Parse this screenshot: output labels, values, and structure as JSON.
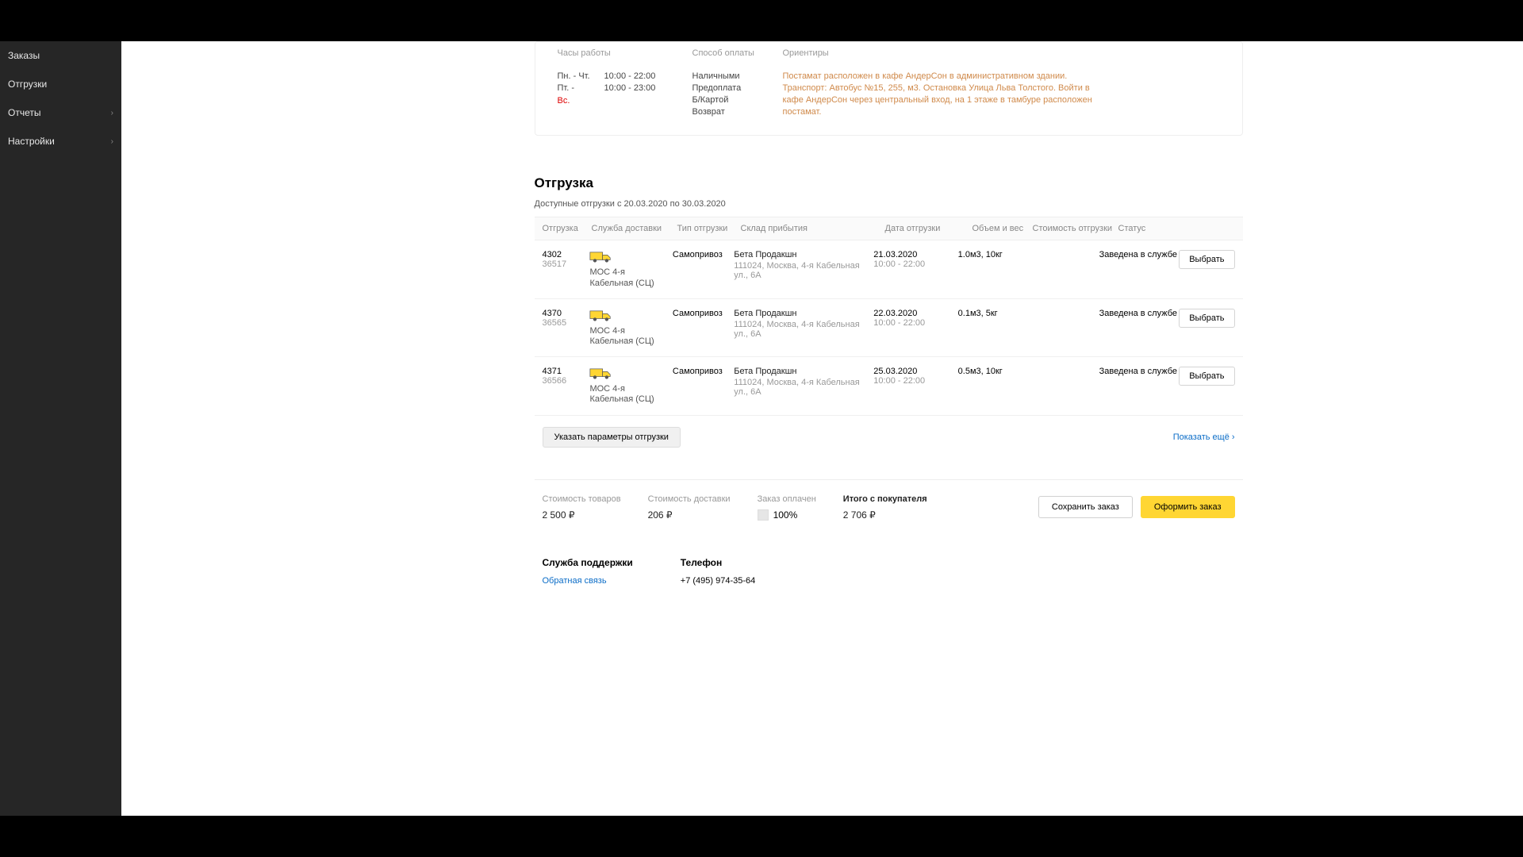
{
  "sidebar": {
    "items": [
      {
        "label": "Заказы",
        "arrow": false
      },
      {
        "label": "Отгрузки",
        "arrow": false
      },
      {
        "label": "Отчеты",
        "arrow": true
      },
      {
        "label": "Настройки",
        "arrow": true
      }
    ]
  },
  "info": {
    "hours_head": "Часы работы",
    "payment_head": "Способ оплаты",
    "landmark_head": "Ориентиры",
    "hours_d1": "Пн. - Чт.",
    "hours_d2a": "Пт. - ",
    "hours_d2b": "Вс.",
    "hours_t1": "10:00 - 22:00",
    "hours_t2": "10:00 - 23:00",
    "pay1": "Наличными",
    "pay2": "Предоплата",
    "pay3": "Б/Картой",
    "pay4": "Возврат",
    "landmark_text": "Постамат расположен в кафе АндерСон в административном здании. Транспорт: Автобус №15, 255, м3. Остановка Улица Льва Толстого. Войти в кафе АндерСон через центральный вход, на 1 этаже в тамбуре расположен постамат."
  },
  "shipment": {
    "title": "Отгрузка",
    "subtitle": "Доступные отгрузки с 20.03.2020 по 30.03.2020",
    "headers": {
      "ship": "Отгрузка",
      "service": "Служба доставки",
      "type": "Тип отгрузки",
      "warehouse": "Склад прибытия",
      "date": "Дата отгрузки",
      "vol": "Объем и вес",
      "cost": "Стоимость отгрузки",
      "status": "Статус"
    },
    "rows": [
      {
        "num": "4302",
        "sub": "36517",
        "svc": "МОС 4-я Кабельная (СЦ)",
        "type": "Самопривоз",
        "wh": "Бета Продакшн",
        "addr": "111024, Москва, 4-я Кабельная ул., 6А",
        "date": "21.03.2020",
        "time": "10:00 - 22:00",
        "vol": "1.0м3, 10кг",
        "status": "Заведена в службе"
      },
      {
        "num": "4370",
        "sub": "36565",
        "svc": "МОС 4-я Кабельная (СЦ)",
        "type": "Самопривоз",
        "wh": "Бета Продакшн",
        "addr": "111024, Москва, 4-я Кабельная ул., 6А",
        "date": "22.03.2020",
        "time": "10:00 - 22:00",
        "vol": "0.1м3, 5кг",
        "status": "Заведена в службе"
      },
      {
        "num": "4371",
        "sub": "36566",
        "svc": "МОС 4-я Кабельная (СЦ)",
        "type": "Самопривоз",
        "wh": "Бета Продакшн",
        "addr": "111024, Москва, 4-я Кабельная ул., 6А",
        "date": "25.03.2020",
        "time": "10:00 - 22:00",
        "vol": "0.5м3, 10кг",
        "status": "Заведена в службе"
      }
    ],
    "select_label": "Выбрать",
    "params_button": "Указать параметры отгрузки",
    "show_more": "Показать ещё"
  },
  "summary": {
    "goods_label": "Стоимость товаров",
    "goods_val": "2 500 ₽",
    "delivery_label": "Стоимость доставки",
    "delivery_val": "206 ₽",
    "paid_label": "Заказ оплачен",
    "paid_val": "100%",
    "total_label": "Итого с покупателя",
    "total_val": "2 706 ₽",
    "save_btn": "Сохранить заказ",
    "submit_btn": "Оформить заказ"
  },
  "footer": {
    "support_head": "Служба поддержки",
    "support_link": "Обратная связь",
    "phone_head": "Телефон",
    "phone_val": "+7 (495) 974-35-64"
  }
}
